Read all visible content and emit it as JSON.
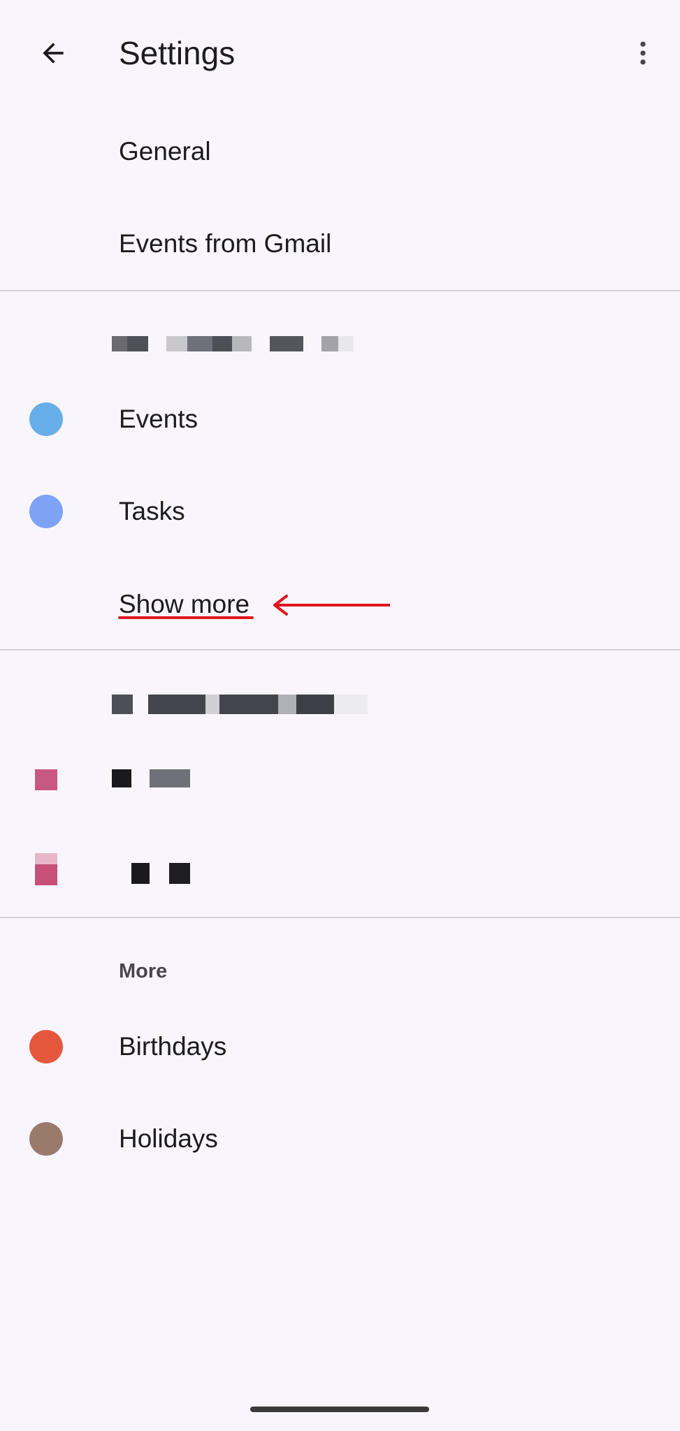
{
  "app_bar": {
    "title": "Settings",
    "back_icon": "arrow-back-icon",
    "overflow_icon": "more-vert-icon"
  },
  "general_items": [
    {
      "label": "General"
    },
    {
      "label": "Events from Gmail"
    }
  ],
  "account_section_1": {
    "items": [
      {
        "label": "Events",
        "color": "#66aee9"
      },
      {
        "label": "Tasks",
        "color": "#7ea2f5"
      }
    ],
    "show_more_label": "Show more"
  },
  "more_section": {
    "header": "More",
    "items": [
      {
        "label": "Birthdays",
        "color": "#e5573d"
      },
      {
        "label": "Holidays",
        "color": "#9a7a6b"
      }
    ]
  },
  "annotation": {
    "color": "#e0161e"
  }
}
